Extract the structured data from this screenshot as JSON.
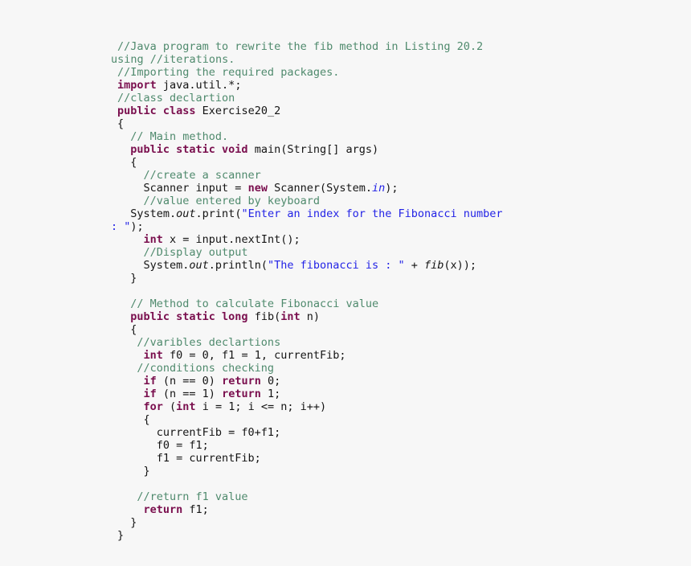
{
  "page": {
    "title": "Java program - Exercise20_2 Fibonacci",
    "background_color": "#f7f7f7",
    "font_size_px": 13.5,
    "line_height_px": 16
  },
  "colors": {
    "plain": "#141414",
    "comment": "#4f8a6d",
    "keyword": "#7a0f4e",
    "string": "#2323e6",
    "field": "#2323e6",
    "method_italic": "#141414"
  },
  "code": {
    "language": "java",
    "lines": [
      {
        "id": "l1",
        "wrapped": false,
        "tokens": [
          {
            "t": "comment",
            "s": "//Java program to rewrite the fib method in Listing 20.2"
          }
        ]
      },
      {
        "id": "l2",
        "wrapped": true,
        "tokens": [
          {
            "t": "comment",
            "s": "using //iterations."
          }
        ]
      },
      {
        "id": "l3",
        "wrapped": false,
        "tokens": [
          {
            "t": "comment",
            "s": "//Importing the required packages."
          }
        ]
      },
      {
        "id": "l4",
        "wrapped": false,
        "tokens": [
          {
            "t": "keyword",
            "s": "import"
          },
          {
            "t": "plain",
            "s": " java.util.*;"
          }
        ]
      },
      {
        "id": "l5",
        "wrapped": false,
        "tokens": [
          {
            "t": "comment",
            "s": "//class declartion"
          }
        ]
      },
      {
        "id": "l6",
        "wrapped": false,
        "tokens": [
          {
            "t": "keyword",
            "s": "public class"
          },
          {
            "t": "plain",
            "s": " Exercise20_2"
          }
        ]
      },
      {
        "id": "l7",
        "wrapped": false,
        "tokens": [
          {
            "t": "plain",
            "s": "{"
          }
        ]
      },
      {
        "id": "l8",
        "wrapped": false,
        "tokens": [
          {
            "t": "comment",
            "s": "  // Main method."
          }
        ]
      },
      {
        "id": "l9",
        "wrapped": false,
        "tokens": [
          {
            "t": "keyword",
            "s": "  public static void"
          },
          {
            "t": "plain",
            "s": " main(String[] args)"
          }
        ]
      },
      {
        "id": "l10",
        "wrapped": false,
        "tokens": [
          {
            "t": "plain",
            "s": "  {"
          }
        ]
      },
      {
        "id": "l11",
        "wrapped": false,
        "tokens": [
          {
            "t": "comment",
            "s": "    //create a scanner"
          }
        ]
      },
      {
        "id": "l12",
        "wrapped": false,
        "tokens": [
          {
            "t": "plain",
            "s": "    Scanner input = "
          },
          {
            "t": "keyword",
            "s": "new"
          },
          {
            "t": "plain",
            "s": " Scanner(System."
          },
          {
            "t": "field",
            "s": "in"
          },
          {
            "t": "plain",
            "s": ");"
          }
        ]
      },
      {
        "id": "l13",
        "wrapped": false,
        "tokens": [
          {
            "t": "comment",
            "s": "    //value entered by keyboard"
          }
        ]
      },
      {
        "id": "l14",
        "wrapped": false,
        "tokens": [
          {
            "t": "plain",
            "s": "  System."
          },
          {
            "t": "method",
            "s": "out"
          },
          {
            "t": "plain",
            "s": ".print("
          },
          {
            "t": "string",
            "s": "\"Enter an index for the Fibonacci number"
          }
        ]
      },
      {
        "id": "l15",
        "wrapped": true,
        "tokens": [
          {
            "t": "string",
            "s": ": \""
          },
          {
            "t": "plain",
            "s": ");"
          }
        ]
      },
      {
        "id": "l16",
        "wrapped": false,
        "tokens": [
          {
            "t": "keyword",
            "s": "    int"
          },
          {
            "t": "plain",
            "s": " x = input.nextInt();"
          }
        ]
      },
      {
        "id": "l17",
        "wrapped": false,
        "tokens": [
          {
            "t": "comment",
            "s": "    //Display output"
          }
        ]
      },
      {
        "id": "l18",
        "wrapped": false,
        "tokens": [
          {
            "t": "plain",
            "s": "    System."
          },
          {
            "t": "method",
            "s": "out"
          },
          {
            "t": "plain",
            "s": ".println("
          },
          {
            "t": "string",
            "s": "\"The fibonacci is : \""
          },
          {
            "t": "plain",
            "s": " + "
          },
          {
            "t": "method",
            "s": "fib"
          },
          {
            "t": "plain",
            "s": "(x));"
          }
        ]
      },
      {
        "id": "l19",
        "wrapped": false,
        "tokens": [
          {
            "t": "plain",
            "s": "  }"
          }
        ]
      },
      {
        "id": "l20",
        "wrapped": false,
        "tokens": [
          {
            "t": "plain",
            "s": ""
          }
        ]
      },
      {
        "id": "l21",
        "wrapped": false,
        "tokens": [
          {
            "t": "comment",
            "s": "  // Method to calculate Fibonacci value"
          }
        ]
      },
      {
        "id": "l22",
        "wrapped": false,
        "tokens": [
          {
            "t": "keyword",
            "s": "  public static long"
          },
          {
            "t": "plain",
            "s": " fib("
          },
          {
            "t": "keyword",
            "s": "int"
          },
          {
            "t": "plain",
            "s": " n)"
          }
        ]
      },
      {
        "id": "l23",
        "wrapped": false,
        "tokens": [
          {
            "t": "plain",
            "s": "  {"
          }
        ]
      },
      {
        "id": "l24",
        "wrapped": false,
        "tokens": [
          {
            "t": "comment",
            "s": "   //varibles declartions"
          }
        ]
      },
      {
        "id": "l25",
        "wrapped": false,
        "tokens": [
          {
            "t": "keyword",
            "s": "    int"
          },
          {
            "t": "plain",
            "s": " f0 = 0, f1 = 1, currentFib;"
          }
        ]
      },
      {
        "id": "l26",
        "wrapped": false,
        "tokens": [
          {
            "t": "comment",
            "s": "   //conditions checking"
          }
        ]
      },
      {
        "id": "l27",
        "wrapped": false,
        "tokens": [
          {
            "t": "keyword",
            "s": "    if"
          },
          {
            "t": "plain",
            "s": " (n == 0) "
          },
          {
            "t": "keyword",
            "s": "return"
          },
          {
            "t": "plain",
            "s": " 0;"
          }
        ]
      },
      {
        "id": "l28",
        "wrapped": false,
        "tokens": [
          {
            "t": "keyword",
            "s": "    if"
          },
          {
            "t": "plain",
            "s": " (n == 1) "
          },
          {
            "t": "keyword",
            "s": "return"
          },
          {
            "t": "plain",
            "s": " 1;"
          }
        ]
      },
      {
        "id": "l29",
        "wrapped": false,
        "tokens": [
          {
            "t": "keyword",
            "s": "    for"
          },
          {
            "t": "plain",
            "s": " ("
          },
          {
            "t": "keyword",
            "s": "int"
          },
          {
            "t": "plain",
            "s": " i = 1; i <= n; i++)"
          }
        ]
      },
      {
        "id": "l30",
        "wrapped": false,
        "tokens": [
          {
            "t": "plain",
            "s": "    {"
          }
        ]
      },
      {
        "id": "l31",
        "wrapped": false,
        "tokens": [
          {
            "t": "plain",
            "s": "      currentFib = f0+f1;"
          }
        ]
      },
      {
        "id": "l32",
        "wrapped": false,
        "tokens": [
          {
            "t": "plain",
            "s": "      f0 = f1;"
          }
        ]
      },
      {
        "id": "l33",
        "wrapped": false,
        "tokens": [
          {
            "t": "plain",
            "s": "      f1 = currentFib;"
          }
        ]
      },
      {
        "id": "l34",
        "wrapped": false,
        "tokens": [
          {
            "t": "plain",
            "s": "    }"
          }
        ]
      },
      {
        "id": "l35",
        "wrapped": false,
        "tokens": [
          {
            "t": "plain",
            "s": ""
          }
        ]
      },
      {
        "id": "l36",
        "wrapped": false,
        "tokens": [
          {
            "t": "comment",
            "s": "   //return f1 value"
          }
        ]
      },
      {
        "id": "l37",
        "wrapped": false,
        "tokens": [
          {
            "t": "keyword",
            "s": "    return"
          },
          {
            "t": "plain",
            "s": " f1;"
          }
        ]
      },
      {
        "id": "l38",
        "wrapped": false,
        "tokens": [
          {
            "t": "plain",
            "s": "  }"
          }
        ]
      },
      {
        "id": "l39",
        "wrapped": false,
        "tokens": [
          {
            "t": "plain",
            "s": "}"
          }
        ]
      }
    ]
  }
}
